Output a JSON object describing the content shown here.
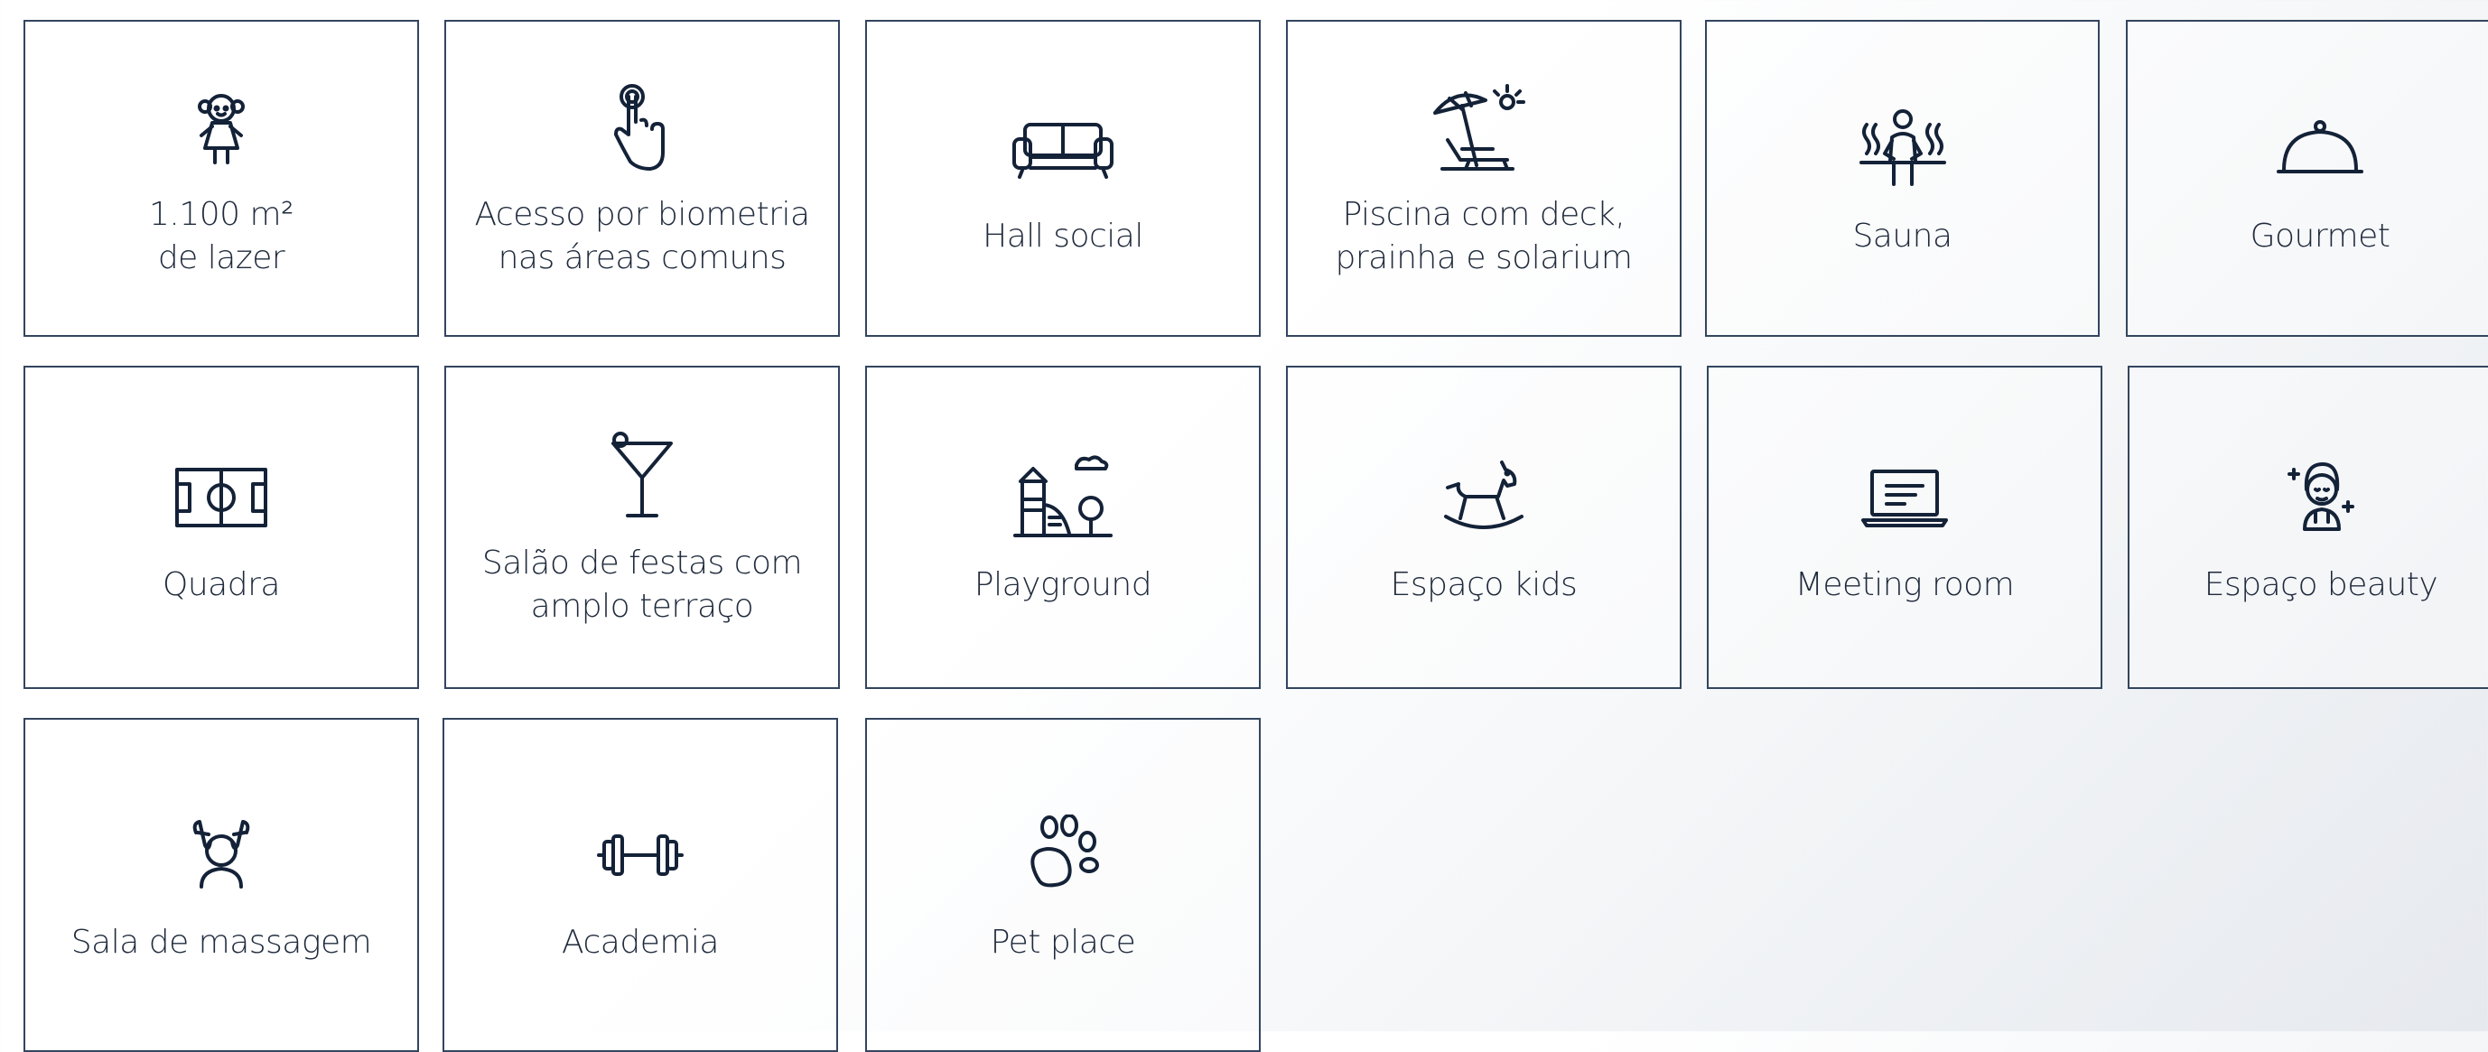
{
  "amenities": [
    {
      "label": "1.100 m²\nde lazer",
      "icon": "doll-icon"
    },
    {
      "label": "Acesso por biometria\nnas áreas comuns",
      "icon": "fingerprint-touch-icon"
    },
    {
      "label": "Hall social",
      "icon": "sofa-icon"
    },
    {
      "label": "Piscina com deck,\nprainha e solarium",
      "icon": "beach-umbrella-icon"
    },
    {
      "label": "Sauna",
      "icon": "sauna-icon"
    },
    {
      "label": "Gourmet",
      "icon": "cloche-icon"
    },
    {
      "label": "Quadra",
      "icon": "soccer-field-icon"
    },
    {
      "label": "Salão de festas com\namplo terraço",
      "icon": "cocktail-icon"
    },
    {
      "label": "Playground",
      "icon": "playground-icon"
    },
    {
      "label": "Espaço kids",
      "icon": "rocking-horse-icon"
    },
    {
      "label": "Meeting room",
      "icon": "laptop-icon"
    },
    {
      "label": "Espaço beauty",
      "icon": "beauty-face-icon"
    },
    {
      "label": "Sala de massagem",
      "icon": "massage-icon"
    },
    {
      "label": "Academia",
      "icon": "dumbbell-icon"
    },
    {
      "label": "Pet place",
      "icon": "paw-icon"
    }
  ]
}
